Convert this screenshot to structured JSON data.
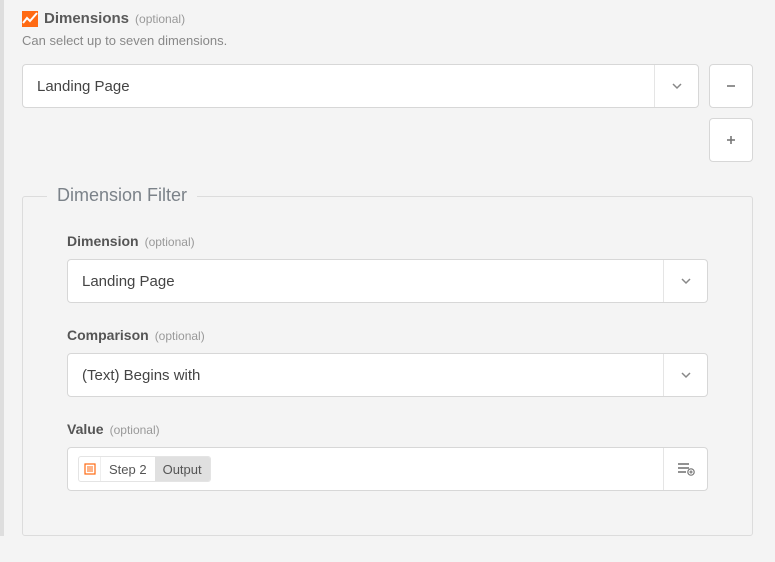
{
  "dimensions": {
    "title": "Dimensions",
    "optional": "(optional)",
    "helper": "Can select up to seven dimensions.",
    "selected": "Landing Page"
  },
  "filter": {
    "legend": "Dimension Filter",
    "dimension": {
      "label": "Dimension",
      "optional": "(optional)",
      "selected": "Landing Page"
    },
    "comparison": {
      "label": "Comparison",
      "optional": "(optional)",
      "selected": "(Text) Begins with"
    },
    "value": {
      "label": "Value",
      "optional": "(optional)",
      "pill_main": "Step 2",
      "pill_sub": "Output"
    }
  }
}
